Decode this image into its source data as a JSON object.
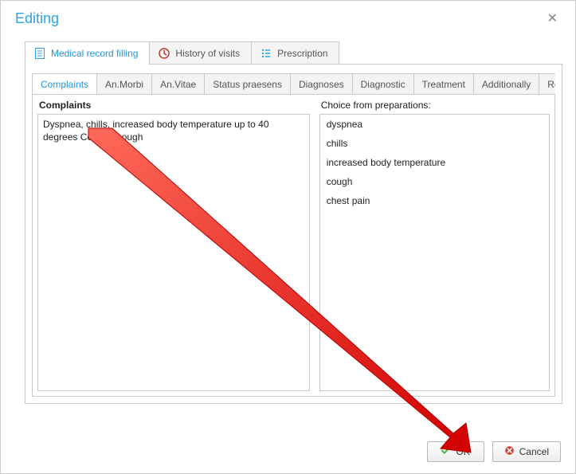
{
  "window": {
    "title": "Editing"
  },
  "outerTabs": [
    {
      "label": "Medical record filling"
    },
    {
      "label": "History of visits"
    },
    {
      "label": "Prescription"
    }
  ],
  "innerTabs": [
    {
      "label": "Complaints"
    },
    {
      "label": "An.Morbi"
    },
    {
      "label": "An.Vitae"
    },
    {
      "label": "Status praesens"
    },
    {
      "label": "Diagnoses"
    },
    {
      "label": "Diagnostic"
    },
    {
      "label": "Treatment"
    },
    {
      "label": "Additionally"
    },
    {
      "label": "Result"
    }
  ],
  "complaintsPanel": {
    "leftHeader": "Complaints",
    "leftText": "Dyspnea, chills, increased body temperature up to 40 degrees Celsius, cough",
    "rightHeader": "Choice from preparations:",
    "options": [
      "dyspnea",
      "chills",
      "increased body temperature",
      "cough",
      "chest pain"
    ]
  },
  "buttons": {
    "ok": "OK",
    "cancel": "Cancel"
  }
}
